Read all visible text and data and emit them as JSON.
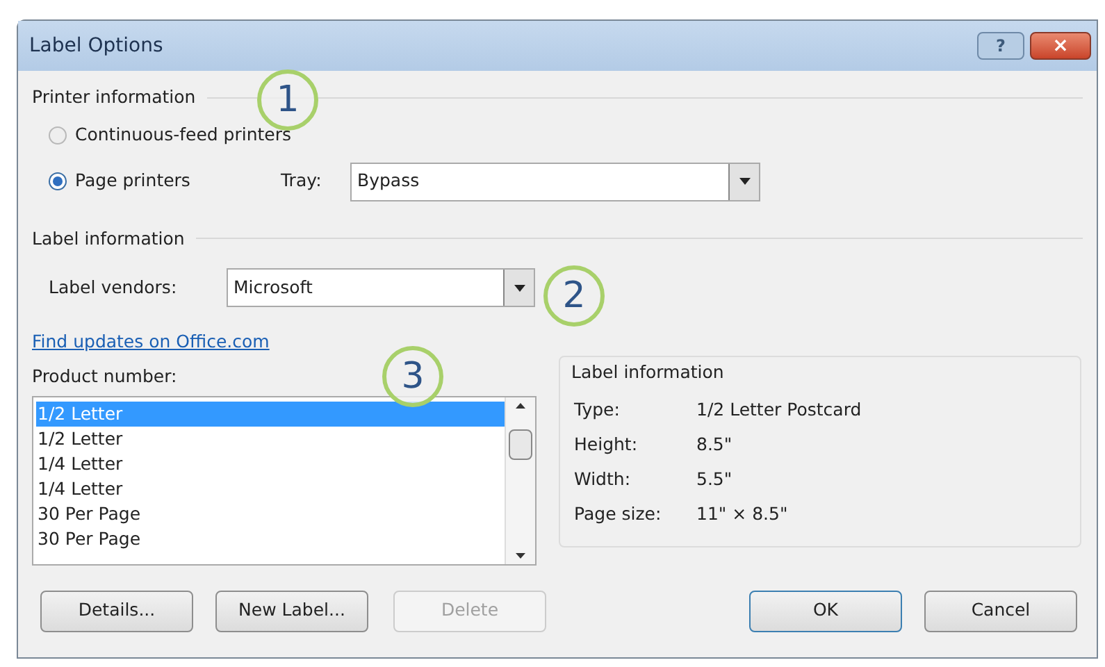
{
  "window": {
    "title": "Label Options",
    "help_button": "?",
    "close_button": "×"
  },
  "printer_information": {
    "heading": "Printer information",
    "options": [
      {
        "label": "Continuous-feed printers",
        "selected": false
      },
      {
        "label": "Page printers",
        "selected": true
      }
    ],
    "tray": {
      "label": "Tray:",
      "value": "Bypass"
    }
  },
  "label_information": {
    "heading": "Label information",
    "vendors": {
      "label": "Label vendors:",
      "value": "Microsoft"
    }
  },
  "link": "Find updates on Office.com",
  "product_number": {
    "label": "Product number:",
    "items": [
      {
        "text": "1/2 Letter",
        "selected": true
      },
      {
        "text": "1/2 Letter",
        "selected": false
      },
      {
        "text": "1/4 Letter",
        "selected": false
      },
      {
        "text": "1/4 Letter",
        "selected": false
      },
      {
        "text": "30 Per Page",
        "selected": false
      },
      {
        "text": "30 Per Page",
        "selected": false
      }
    ]
  },
  "details": {
    "heading": "Label information",
    "rows": [
      {
        "label": "Type:",
        "value": "1/2 Letter Postcard"
      },
      {
        "label": "Height:",
        "value": "8.5\""
      },
      {
        "label": "Width:",
        "value": "5.5\""
      },
      {
        "label": "Page size:",
        "value": "11\" × 8.5\""
      }
    ]
  },
  "buttons": [
    {
      "label": "Details...",
      "disabled": false
    },
    {
      "label": "New Label...",
      "disabled": false
    },
    {
      "label": "Delete",
      "disabled": true
    },
    {
      "label": "OK",
      "disabled": false
    },
    {
      "label": "Cancel",
      "disabled": false
    }
  ],
  "callouts": [
    "1",
    "2",
    "3"
  ]
}
